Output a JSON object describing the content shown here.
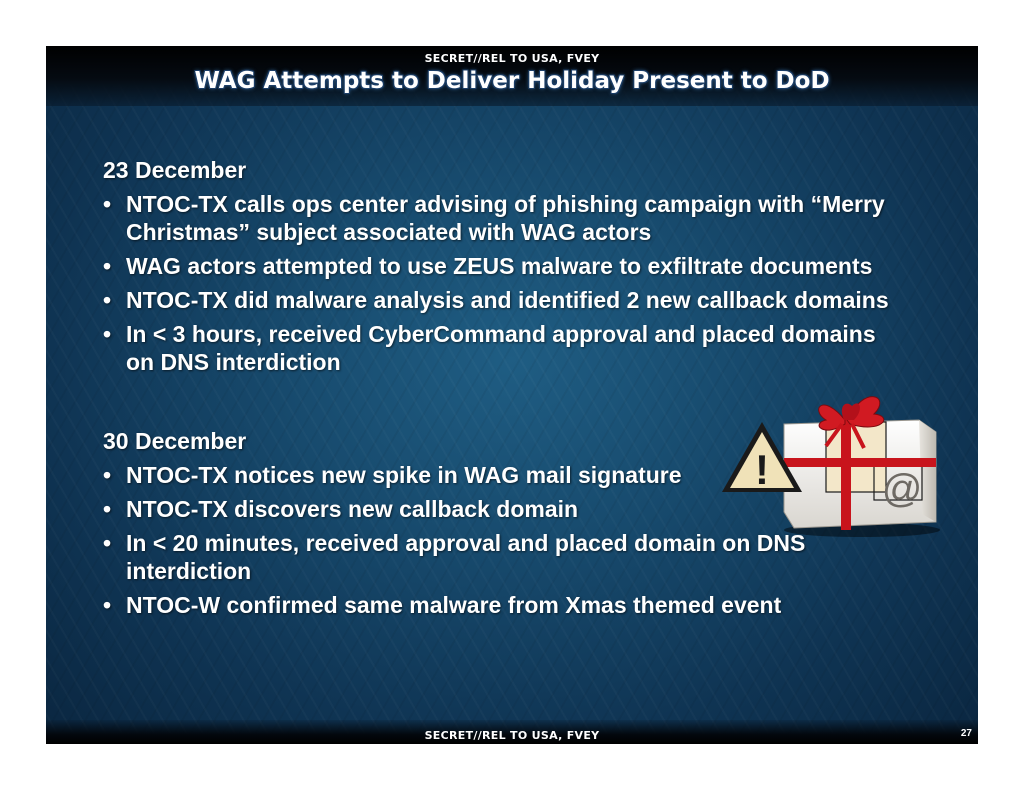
{
  "header": {
    "classification_top": "SECRET//REL TO USA, FVEY",
    "title": "WAG Attempts to Deliver Holiday Present to DoD"
  },
  "sections": [
    {
      "heading": "23 December",
      "bullets": [
        "NTOC-TX calls ops center advising of phishing campaign with “Merry Christmas” subject associated with WAG actors",
        "WAG actors attempted to use ZEUS malware to exfiltrate documents",
        "NTOC-TX did malware analysis and identified 2 new callback domains",
        "In < 3 hours, received CyberCommand approval and placed domains on DNS interdiction"
      ]
    },
    {
      "heading": "30 December",
      "bullets": [
        "NTOC-TX notices new spike in WAG mail signature",
        "NTOC-TX discovers new callback domain",
        "In < 20 minutes, received approval and placed domain on DNS interdiction",
        "NTOC-W confirmed same malware from Xmas themed event"
      ]
    }
  ],
  "illustration": {
    "icons": [
      "warning-icon",
      "gift-box-icon",
      "at-sign-icon"
    ],
    "at_symbol": "@",
    "warning_symbol": "!"
  },
  "footer": {
    "classification_bottom": "SECRET//REL TO USA, FVEY",
    "page_number": "27"
  },
  "colors": {
    "background_center": "#1f5d83",
    "background_edge": "#0a2640",
    "text": "#ffffff",
    "ribbon": "#c8141c",
    "warning_fill": "#f0e2b8"
  }
}
